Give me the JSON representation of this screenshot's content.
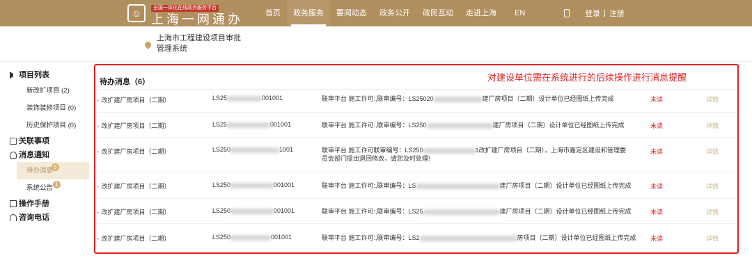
{
  "header": {
    "logo_tag": "全国一体化在线政务服务平台",
    "logo_name": "上海一网通办",
    "nav": [
      "首页",
      "政务服务",
      "要闻动态",
      "政务公开",
      "政民互动",
      "走进上海",
      "EN"
    ],
    "active_nav": "政务服务",
    "login": "登录",
    "register": "注册",
    "separator": "|"
  },
  "sub_header": {
    "system_name": "上海市工程建设项目审批管理系统"
  },
  "sidebar": {
    "groups": [
      {
        "label": "项目列表",
        "icon": "list-icon",
        "items": [
          {
            "label": "新改扩项目 (2)"
          },
          {
            "label": "装饰装修项目 (0)"
          },
          {
            "label": "历史保护项目 (0)"
          }
        ]
      },
      {
        "label": "关联事项",
        "icon": "document-icon",
        "items": []
      },
      {
        "label": "消息通知",
        "icon": "bell-icon",
        "items": [
          {
            "label": "待办消息",
            "badge": "6",
            "active": true
          },
          {
            "label": "系统公告",
            "badge": "1"
          }
        ]
      },
      {
        "label": "操作手册",
        "icon": "book-icon",
        "items": []
      },
      {
        "label": "咨询电话",
        "icon": "headset-icon",
        "items": []
      }
    ]
  },
  "main": {
    "title": "待办消息（6）",
    "annotation": "对建设单位需在系统进行的后续操作进行消息提醒",
    "rows": [
      {
        "name": "改扩建厂房项目（二期）",
        "code_prefix": "LS25",
        "code_suffix": "001001",
        "msg_a": "联审平台 施工许可:,联审编号：LS25020",
        "msg_b": "建厂房项目（二期）设计单位已经图纸上传完成",
        "status": "未读",
        "detail": "详情"
      },
      {
        "name": "改扩建厂房项目（二期）",
        "code_prefix": "LS25",
        "code_suffix": "001001",
        "msg_a": "联审平台 施工许可:,联审编号：LS250",
        "msg_b": "建厂房项目（二期）设计单位已经图纸上传完成",
        "status": "未读",
        "detail": "详情"
      },
      {
        "name": "改扩建厂房项目（二期）",
        "code_prefix": "LS250",
        "code_suffix": "1001",
        "msg_a": "联审平台 施工许可联审编号：LS250",
        "msg_b": "1改扩建厂房项目（二期），上海市嘉定区建设和管理委",
        "msg_c": "员会部门提出退回修改，请您及时处理!",
        "status": "未读",
        "detail": "详情"
      },
      {
        "name": "改扩建厂房项目（二期）",
        "code_prefix": "LS250",
        "code_suffix": "001001",
        "msg_a": "联审平台 施工许可:,联审编号：LS",
        "msg_b": "建厂房项目（二期）设计单位已经图纸上传完成",
        "status": "未读",
        "detail": "详情"
      },
      {
        "name": "改扩建厂房项目（二期）",
        "code_prefix": "LS250",
        "code_suffix": "001001",
        "msg_a": "联审平台 施工许可:,联审编号：LS25",
        "msg_b": "建厂房项目（二期）设计单位已经图纸上传完成",
        "status": "未读",
        "detail": "详情"
      },
      {
        "name": "改扩建厂房项目（二期）",
        "code_prefix": "LS250",
        "code_suffix": "001001",
        "msg_a": "联审平台 施工许可:,联审编号：LS2",
        "msg_b": "房项目（二期）设计单位已经图纸上传完成",
        "status": "未读",
        "detail": "详情"
      }
    ]
  },
  "colors": {
    "brand": "#b28f5e",
    "alert": "#e02020",
    "badge": "#d9b36e",
    "active_bg": "#f3ead8"
  }
}
